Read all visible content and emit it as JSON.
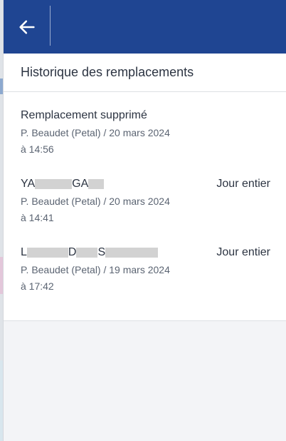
{
  "topbar": {
    "back_icon": "arrow-left-icon",
    "bg_color": "#1f4592"
  },
  "header": {
    "title": "Historique des remplacements"
  },
  "items": [
    {
      "title_parts": [
        "Remplacement supprimé"
      ],
      "meta_line1": "P. Beaudet (Petal) / 20 mars 2024",
      "meta_line2": "à 14:56",
      "right": ""
    },
    {
      "title_parts": [
        "YA",
        "GA"
      ],
      "meta_line1": "P. Beaudet (Petal) / 20 mars 2024",
      "meta_line2": "à 14:41",
      "right": "Jour entier"
    },
    {
      "title_parts": [
        "L",
        "D",
        "S"
      ],
      "meta_line1": "P. Beaudet (Petal) / 19 mars 2024",
      "meta_line2": "à 17:42",
      "right": "Jour entier"
    }
  ]
}
